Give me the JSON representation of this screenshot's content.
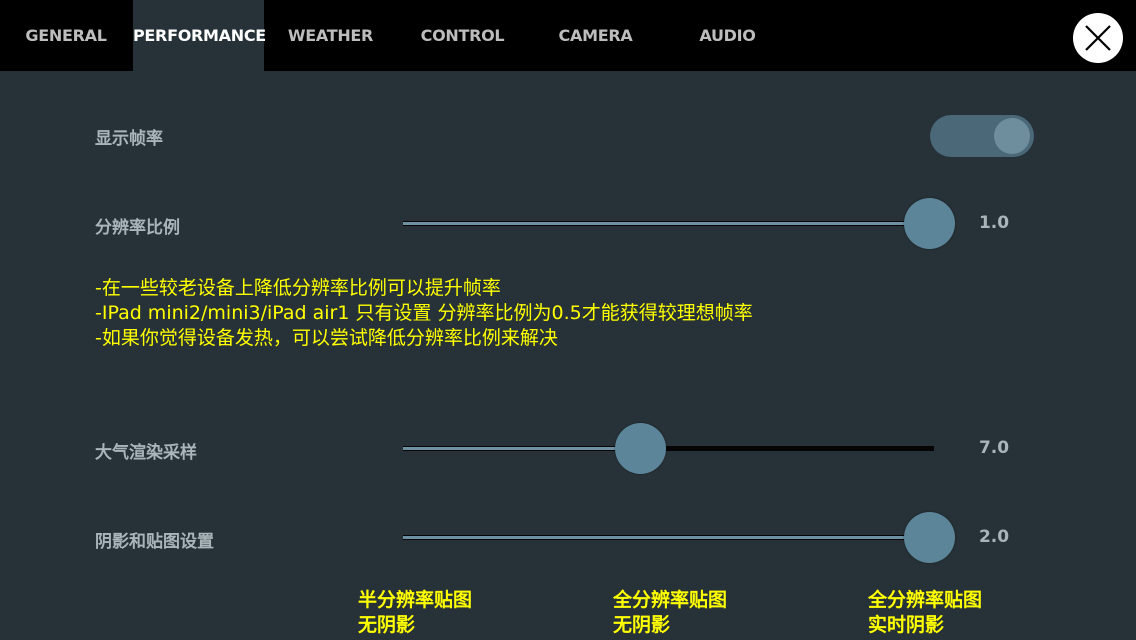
{
  "tabs": [
    {
      "label": "GENERAL",
      "active": false
    },
    {
      "label": "PERFORMANCE",
      "active": true
    },
    {
      "label": "WEATHER",
      "active": false
    },
    {
      "label": "CONTROL",
      "active": false
    },
    {
      "label": "CAMERA",
      "active": false
    },
    {
      "label": "AUDIO",
      "active": false
    }
  ],
  "close_icon": "close-icon",
  "settings": {
    "show_fps": {
      "label": "显示帧率",
      "enabled": true
    },
    "resolution_scale": {
      "label": "分辨率比例",
      "value": "1.0",
      "fraction": 1.0
    },
    "atmosphere_sampling": {
      "label": "大气渲染采样",
      "value": "7.0",
      "fraction": 0.45
    },
    "shadow_texture": {
      "label": "阴影和贴图设置",
      "value": "2.0",
      "fraction": 1.0
    }
  },
  "tips": [
    "-在一些较老设备上降低分辨率比例可以提升帧率",
    "-IPad mini2/mini3/iPad air1 只有设置 分辨率比例为0.5才能获得较理想帧率",
    "-如果你觉得设备发热，可以尝试降低分辨率比例来解决"
  ],
  "shadow_options": [
    {
      "line1": "半分辨率贴图",
      "line2": "无阴影"
    },
    {
      "line1": "全分辨率贴图",
      "line2": "无阴影"
    },
    {
      "line1": "全分辨率贴图",
      "line2": "实时阴影"
    }
  ],
  "colors": {
    "accent": "#5d8599",
    "highlight": "#ffff00",
    "background": "#263238"
  }
}
